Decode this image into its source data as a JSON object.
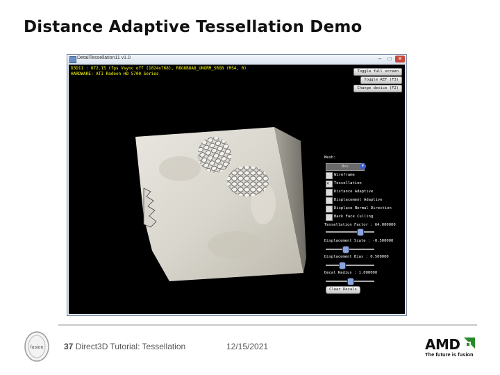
{
  "slide": {
    "title": "Distance Adaptive Tessellation Demo",
    "footer_number": "37",
    "footer_text": "Direct3D Tutorial: Tessellation",
    "date": "12/15/2021",
    "brand": "AMD",
    "tagline": "The future is fusion",
    "fusion_logo_text": "fusion"
  },
  "window": {
    "title": "DetailTessellation11 v1.0",
    "controls": {
      "minimize": "–",
      "maximize": "□",
      "close": "✕"
    }
  },
  "hud": {
    "line1": "D3D11 : 672.15 (fps Vsync off (1024x768), R8G8B8A8_UNORM_SRGB (MS4, 0)",
    "line2": "HARDWARE: ATI Radeon HD 5700 Series"
  },
  "top_buttons": [
    "Toggle full screen",
    "Toggle REF (F3)",
    "Change device (F2)"
  ],
  "panel": {
    "mesh_label": "Mesh:",
    "mesh_value": "Box",
    "checkboxes": [
      {
        "label": "Wireframe",
        "checked": false
      },
      {
        "label": "Tessellation",
        "checked": true
      },
      {
        "label": "Distance Adaptive",
        "checked": false
      },
      {
        "label": "Displacement Adaptive",
        "checked": false
      },
      {
        "label": "Displace Normal Direction",
        "checked": false
      },
      {
        "label": "Back Face Culling",
        "checked": false
      }
    ],
    "sliders": [
      {
        "label": "Tessellation Factor : 64.000000",
        "value": 0.73
      },
      {
        "label": "Displacement Scale : -0.500000",
        "value": 0.38
      },
      {
        "label": "Displacement Bias : 0.500000",
        "value": 0.3
      },
      {
        "label": "Decal Radius : 1.000000",
        "value": 0.5
      }
    ],
    "clear_button": "Clear Decals"
  },
  "colors": {
    "hud_text": "#ffff00",
    "viewport_bg": "#000000",
    "accent": "#3b5fcc",
    "amd_arrow": "#2a8a2a"
  }
}
